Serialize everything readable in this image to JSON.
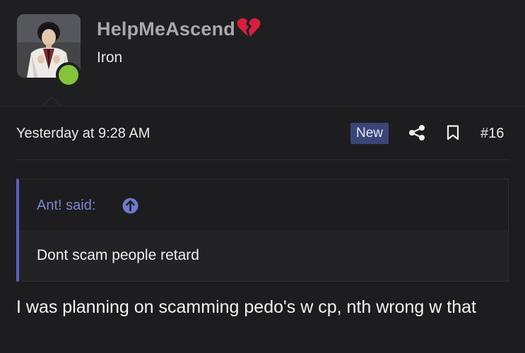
{
  "user": {
    "name": "HelpMeAscend",
    "title": "Iron",
    "online": true
  },
  "post": {
    "date": "Yesterday at 9:28 AM",
    "badge": "New",
    "number": "#16"
  },
  "quote": {
    "author": "Ant! said:",
    "text": "Dont scam people retard"
  },
  "message": "I was planning on scamming pedo's w cp, nth wrong w that",
  "colors": {
    "background": "#1d1d1f",
    "badge": "#3a4578",
    "quote_accent": "#5b63b7",
    "online": "#84c43b",
    "broken_heart": "#d81f3f"
  },
  "icons": {
    "share": "share-icon",
    "bookmark": "bookmark-icon",
    "quote_jump": "arrow-up-circle-icon",
    "status_emoji": "broken-heart-icon"
  }
}
